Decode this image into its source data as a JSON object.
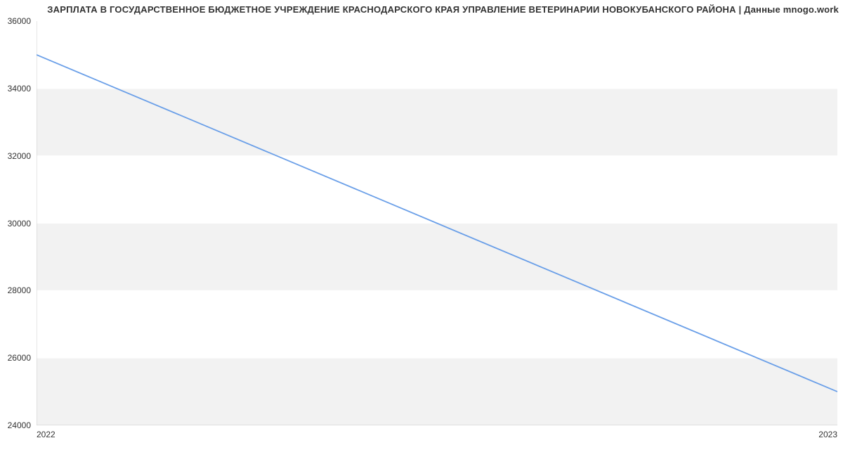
{
  "chart_data": {
    "type": "line",
    "title": "ЗАРПЛАТА В ГОСУДАРСТВЕННОЕ БЮДЖЕТНОЕ УЧРЕЖДЕНИЕ КРАСНОДАРСКОГО КРАЯ УПРАВЛЕНИЕ ВЕТЕРИНАРИИ НОВОКУБАНСКОГО РАЙОНА | Данные mnogo.work",
    "xlabel": "",
    "ylabel": "",
    "x": [
      "2022",
      "2023"
    ],
    "values": [
      35000,
      25000
    ],
    "ylim": [
      24000,
      36000
    ],
    "y_ticks": [
      24000,
      26000,
      28000,
      30000,
      32000,
      34000,
      36000
    ],
    "x_ticks": [
      "2022",
      "2023"
    ],
    "grid": true,
    "line_color": "#6a9fe8",
    "grid_band_color": "#f2f2f2",
    "axis_line_color": "#cccccc"
  }
}
